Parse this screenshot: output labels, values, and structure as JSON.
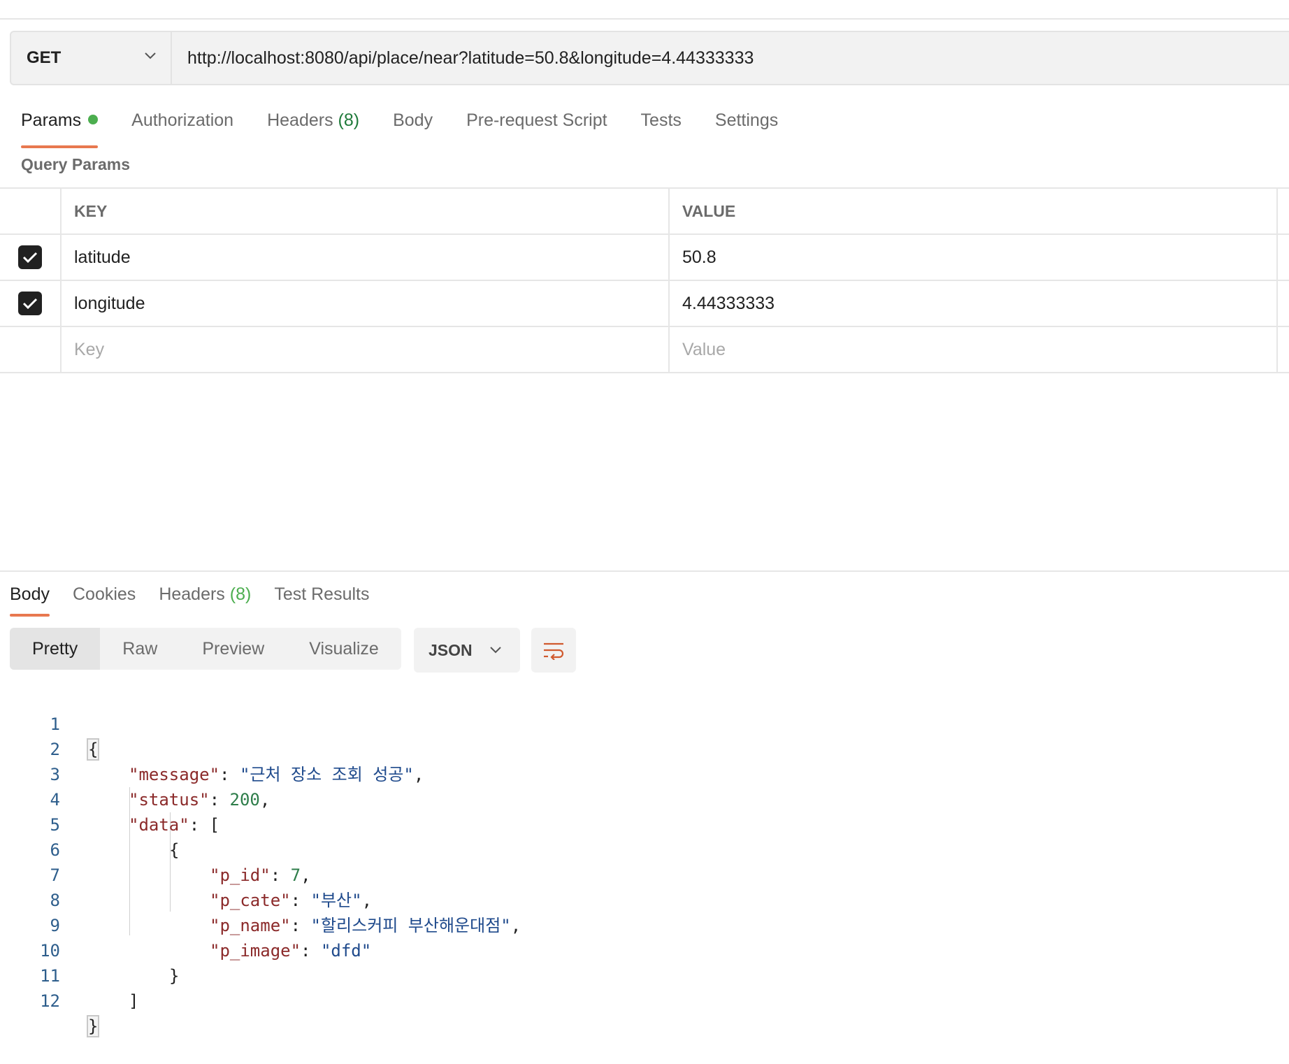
{
  "request": {
    "method": "GET",
    "url": "http://localhost:8080/api/place/near?latitude=50.8&longitude=4.44333333"
  },
  "request_tabs": {
    "params": "Params",
    "authorization": "Authorization",
    "headers": "Headers",
    "headers_count": "(8)",
    "body": "Body",
    "pre_request": "Pre-request Script",
    "tests": "Tests",
    "settings": "Settings"
  },
  "query_params": {
    "title": "Query Params",
    "key_header": "KEY",
    "value_header": "VALUE",
    "rows": [
      {
        "key": "latitude",
        "value": "50.8",
        "checked": true
      },
      {
        "key": "longitude",
        "value": "4.44333333",
        "checked": true
      }
    ],
    "key_placeholder": "Key",
    "value_placeholder": "Value"
  },
  "response_tabs": {
    "body": "Body",
    "cookies": "Cookies",
    "headers": "Headers",
    "headers_count": "(8)",
    "test_results": "Test Results"
  },
  "view_modes": {
    "pretty": "Pretty",
    "raw": "Raw",
    "preview": "Preview",
    "visualize": "Visualize",
    "format": "JSON"
  },
  "code": {
    "line_numbers": [
      "1",
      "2",
      "3",
      "4",
      "5",
      "6",
      "7",
      "8",
      "9",
      "10",
      "11",
      "12"
    ],
    "open_brace": "{",
    "close_brace": "}",
    "message_key": "\"message\"",
    "message_value": "\"근처 장소 조회 성공\"",
    "status_key": "\"status\"",
    "status_value": "200",
    "data_key": "\"data\"",
    "open_bracket": "[",
    "close_bracket": "]",
    "item_open": "{",
    "item_close": "}",
    "p_id_key": "\"p_id\"",
    "p_id_value": "7",
    "p_cate_key": "\"p_cate\"",
    "p_cate_value": "\"부산\"",
    "p_name_key": "\"p_name\"",
    "p_name_value": "\"할리스커피 부산해운대점\"",
    "p_image_key": "\"p_image\"",
    "p_image_value": "\"dfd\"",
    "colon": ": ",
    "comma": ","
  },
  "colors": {
    "accent": "#e8784f",
    "green": "#4cae4f",
    "key": "#8b2a2a",
    "string": "#1f4a8c",
    "number": "#2e7d4a"
  }
}
